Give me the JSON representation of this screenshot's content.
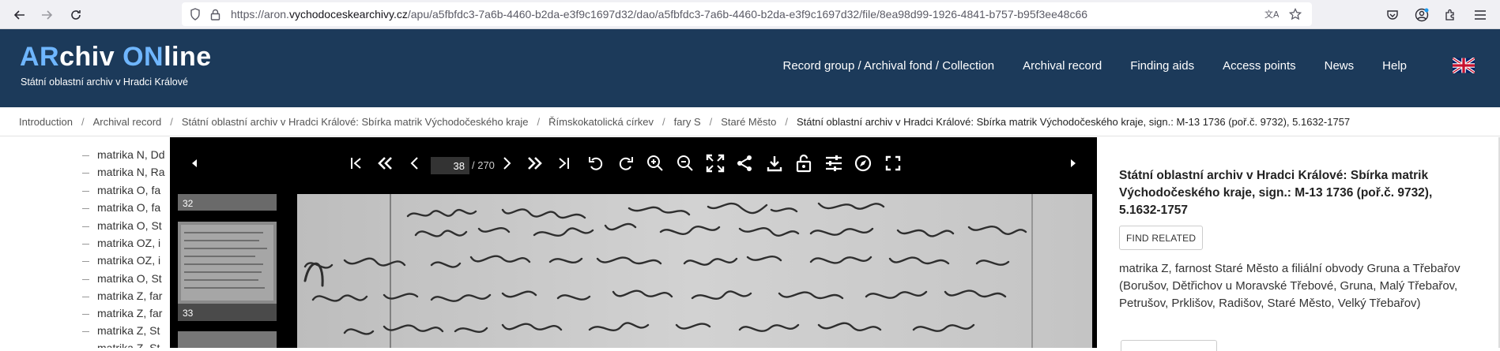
{
  "browser": {
    "url_prefix": "https://aron.",
    "url_domain": "vychodoceskearchivy.cz",
    "url_path": "/apu/a5fbfdc3-7a6b-4460-b2da-e3f9c1697d32/dao/a5fbfdc3-7a6b-4460-b2da-e3f9c1697d32/file/8ea98d99-1926-4841-b757-b95f3ee48c66"
  },
  "header": {
    "logo_ar": "AR",
    "logo_chiv": "chiv ",
    "logo_on": "ON",
    "logo_line": "line",
    "subtitle": "Státní oblastní archiv v Hradci Králové",
    "nav": [
      "Record group / Archival fond / Collection",
      "Archival record",
      "Finding aids",
      "Access points",
      "News",
      "Help"
    ]
  },
  "breadcrumbs": [
    "Introduction",
    "Archival record",
    "Státní oblastní archiv v Hradci Králové: Sbírka matrik Východočeského kraje",
    "Římskokatolická církev",
    "fary S",
    "Staré Město",
    "Státní oblastní archiv v Hradci Králové: Sbírka matrik Východočeského kraje, sign.: M-13 1736 (poř.č. 9732), 5.1632-1757"
  ],
  "tree": [
    "matrika N, Dd",
    "matrika N, Ra",
    "matrika O, fa",
    "matrika O, fa",
    "matrika O, St",
    "matrika OZ, i",
    "matrika OZ, i",
    "matrika O, St",
    "matrika Z, far",
    "matrika Z, far",
    "matrika Z, St",
    "matrika Z, St"
  ],
  "viewer": {
    "page_current": "38",
    "page_total": "/ 270",
    "thumbs": [
      "32",
      "33"
    ]
  },
  "side": {
    "title": "Státní oblastní archiv v Hradci Králové: Sbírka matrik Východočeského kraje, sign.: M-13 1736 (poř.č. 9732), 5.1632-1757",
    "find_related": "FIND RELATED",
    "description": "matrika Z, farnost Staré Město a filiální obvody Gruna a Třebařov (Borušov, Dětřichov u Moravské Třebové, Gruna, Malý Třebařov, Petrušov, Prklišov, Radišov, Staré Město, Velký Třebařov)"
  },
  "colors": {
    "header_bg": "#1c3a5a",
    "logo_accent": "#6fb6ff",
    "viewer_bg": "#000000"
  }
}
